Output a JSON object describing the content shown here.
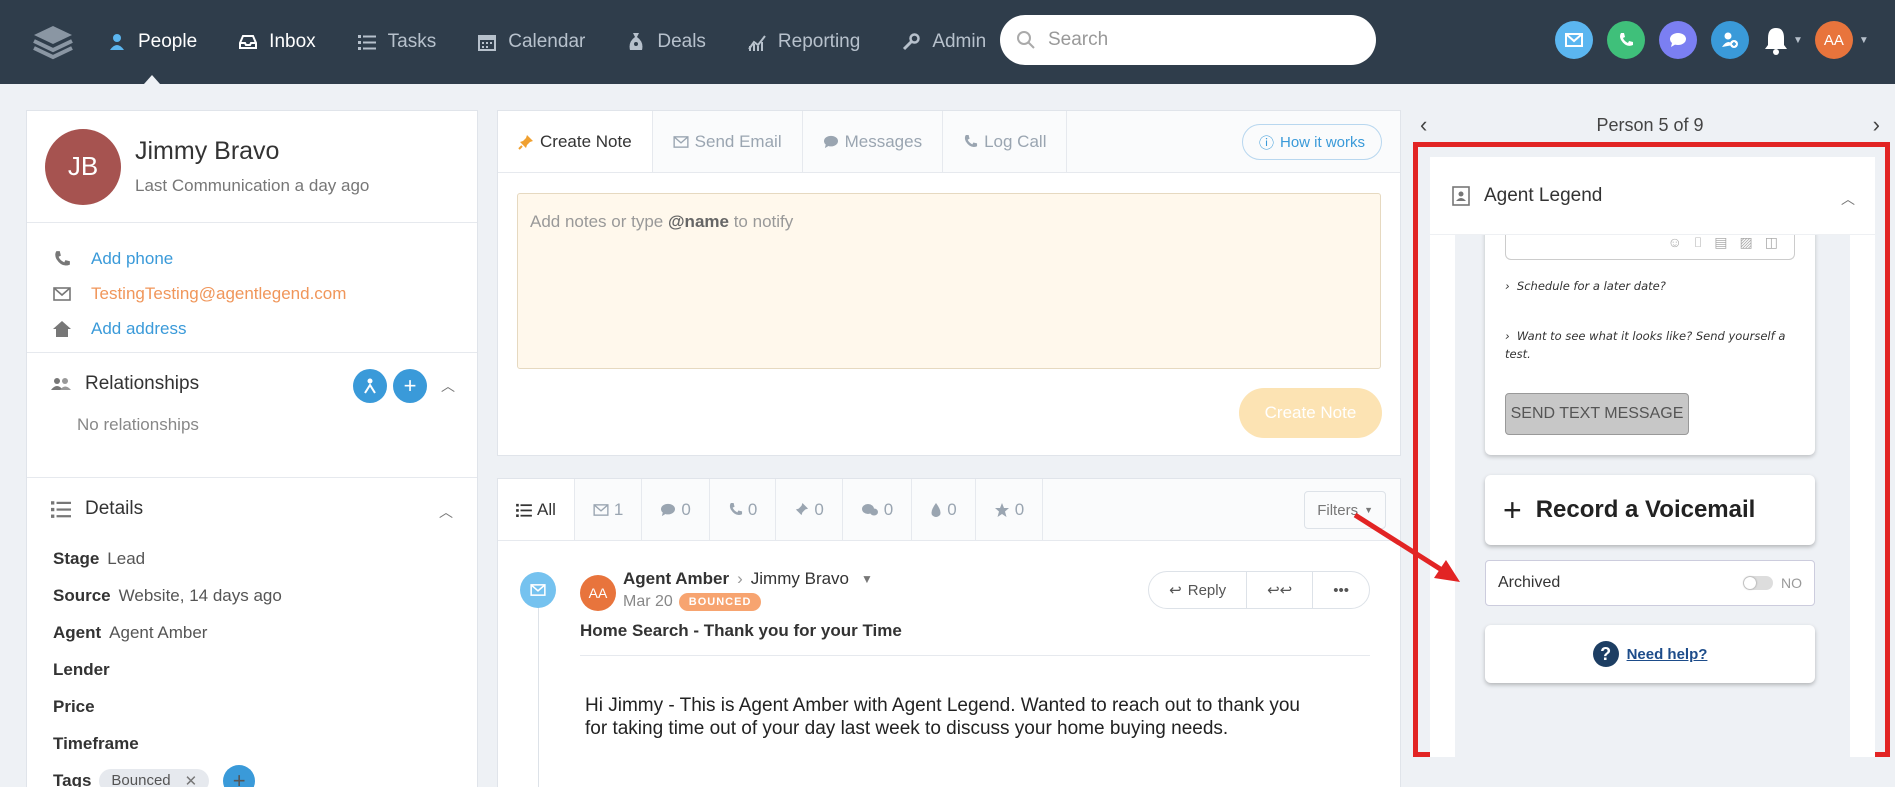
{
  "nav": {
    "items": [
      {
        "label": "People",
        "icon": "person-icon",
        "active": true
      },
      {
        "label": "Inbox",
        "icon": "inbox-icon",
        "active": true
      },
      {
        "label": "Tasks",
        "icon": "list-icon",
        "active": false
      },
      {
        "label": "Calendar",
        "icon": "calendar-icon",
        "active": false
      },
      {
        "label": "Deals",
        "icon": "money-bag-icon",
        "active": false
      },
      {
        "label": "Reporting",
        "icon": "chart-icon",
        "active": false
      },
      {
        "label": "Admin",
        "icon": "wrench-icon",
        "active": false
      }
    ],
    "search_placeholder": "Search",
    "user_initials": "AA"
  },
  "person": {
    "initials": "JB",
    "name": "Jimmy Bravo",
    "last_comm": "Last Communication a day ago",
    "add_phone": "Add phone",
    "email": "TestingTesting@agentlegend.com",
    "add_address": "Add address"
  },
  "relationships": {
    "title": "Relationships",
    "empty": "No relationships"
  },
  "details": {
    "title": "Details",
    "stage_label": "Stage",
    "stage": "Lead",
    "source_label": "Source",
    "source": "Website, 14 days ago",
    "agent_label": "Agent",
    "agent": "Agent Amber",
    "lender_label": "Lender",
    "price_label": "Price",
    "timeframe_label": "Timeframe",
    "tags_label": "Tags",
    "tag": "Bounced"
  },
  "composer": {
    "tabs": [
      "Create Note",
      "Send Email",
      "Messages",
      "Log Call"
    ],
    "how_it_works": "How it works",
    "placeholder_pre": "Add notes or type ",
    "placeholder_bold": "@name",
    "placeholder_post": " to notify",
    "create_button": "Create Note"
  },
  "feed": {
    "all_label": "All",
    "counts": [
      "1",
      "0",
      "0",
      "0",
      "0",
      "0",
      "0"
    ],
    "filters": "Filters",
    "from": "Agent Amber",
    "to": "Jimmy Bravo",
    "avatar": "AA",
    "date": "Mar 20",
    "badge": "BOUNCED",
    "subject": "Home Search - Thank you for your Time",
    "reply": "Reply",
    "body": "Hi Jimmy - This is Agent Amber with Agent Legend. Wanted to reach out to thank you for taking time out of your day last week to discuss your home buying needs."
  },
  "right": {
    "person_nav": "Person 5 of 9",
    "legend_title": "Agent Legend",
    "schedule": "Schedule for a later date?",
    "test": "Want to see what it looks like? Send yourself a test.",
    "send_button": "SEND TEXT MESSAGE",
    "voicemail": "Record a Voicemail",
    "archived": "Archived",
    "archived_state": "NO",
    "help": "Need help?"
  },
  "colors": {
    "nav_bg": "#2f3d4b",
    "accent": "#3a9ad9",
    "highlight_border": "#e22424",
    "arrow": "#e22424"
  }
}
